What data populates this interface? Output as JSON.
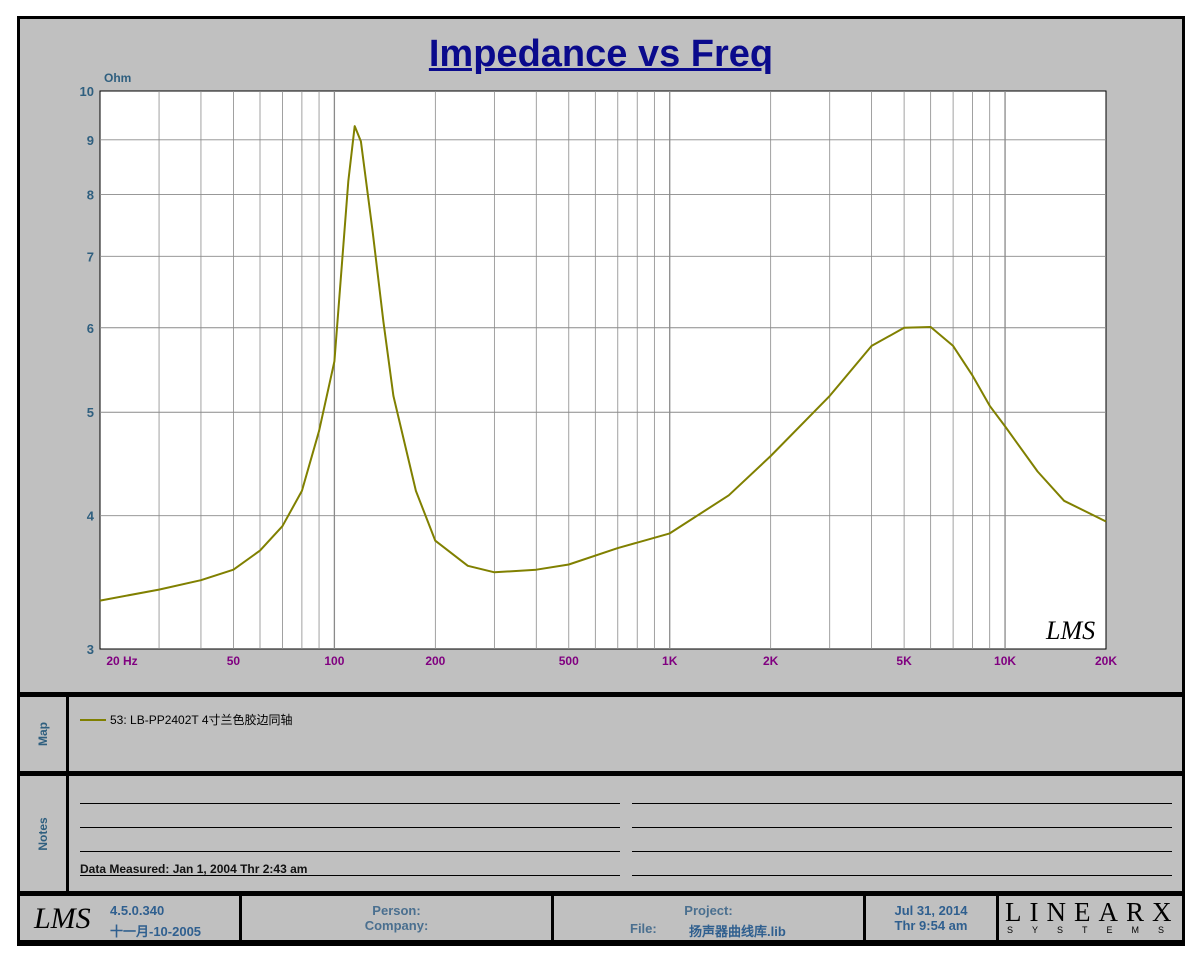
{
  "chart_data": {
    "type": "line",
    "title": "Impedance vs Freq",
    "ylabel": "Ohm",
    "xlabel": "Hz",
    "xscale": "log",
    "yscale": "log",
    "xlim": [
      20,
      20000
    ],
    "ylim": [
      3,
      10
    ],
    "grid": true,
    "x_ticks": [
      {
        "v": 20,
        "label": "20  Hz"
      },
      {
        "v": 50,
        "label": "50"
      },
      {
        "v": 100,
        "label": "100"
      },
      {
        "v": 200,
        "label": "200"
      },
      {
        "v": 500,
        "label": "500"
      },
      {
        "v": 1000,
        "label": "1K"
      },
      {
        "v": 2000,
        "label": "2K"
      },
      {
        "v": 5000,
        "label": "5K"
      },
      {
        "v": 10000,
        "label": "10K"
      },
      {
        "v": 20000,
        "label": "20K"
      }
    ],
    "y_ticks": [
      {
        "v": 3,
        "label": "3"
      },
      {
        "v": 4,
        "label": "4"
      },
      {
        "v": 5,
        "label": "5"
      },
      {
        "v": 6,
        "label": "6"
      },
      {
        "v": 7,
        "label": "7"
      },
      {
        "v": 8,
        "label": "8"
      },
      {
        "v": 9,
        "label": "9"
      },
      {
        "v": 10,
        "label": "10"
      }
    ],
    "series": [
      {
        "name": "53: LB-PP2402T 4寸兰色胶边同轴",
        "color": "#808000",
        "x": [
          20,
          30,
          40,
          50,
          60,
          70,
          80,
          90,
          100,
          110,
          115,
          120,
          130,
          140,
          150,
          175,
          200,
          250,
          300,
          400,
          500,
          700,
          1000,
          1500,
          2000,
          3000,
          4000,
          5000,
          6000,
          7000,
          8000,
          9000,
          10000,
          12500,
          15000,
          20000
        ],
        "y": [
          3.33,
          3.41,
          3.48,
          3.56,
          3.71,
          3.91,
          4.22,
          4.8,
          5.58,
          8.23,
          9.27,
          8.97,
          7.39,
          6.08,
          5.18,
          4.22,
          3.79,
          3.59,
          3.54,
          3.56,
          3.6,
          3.73,
          3.85,
          4.18,
          4.55,
          5.18,
          5.77,
          6.0,
          6.01,
          5.77,
          5.41,
          5.07,
          4.85,
          4.4,
          4.13,
          3.95
        ]
      }
    ],
    "watermark": "LMS"
  },
  "map": {
    "label": "Map"
  },
  "notes": {
    "label": "Notes",
    "measured": "Data Measured: Jan  1, 2004  Thr  2:43 am"
  },
  "footer": {
    "version": "4.5.0.340",
    "build_date": "十一月-10-2005",
    "person": "Person:",
    "company": "Company:",
    "project": "Project:",
    "file_label": "File:",
    "file": "扬声器曲线库.lib",
    "date": "Jul 31, 2014",
    "time": "Thr  9:54 am",
    "logo": "LINEARX",
    "logo_sub": "SYSTEMS",
    "lms_logo": "LMS"
  }
}
